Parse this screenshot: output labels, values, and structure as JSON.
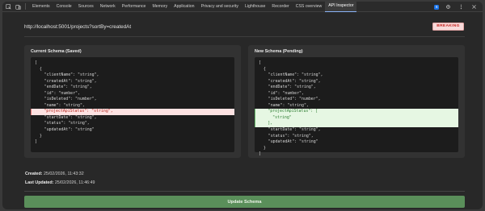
{
  "devtools": {
    "tabs": [
      {
        "label": "Elements"
      },
      {
        "label": "Console"
      },
      {
        "label": "Sources"
      },
      {
        "label": "Network"
      },
      {
        "label": "Performance"
      },
      {
        "label": "Memory"
      },
      {
        "label": "Application"
      },
      {
        "label": "Privacy and security"
      },
      {
        "label": "Lighthouse"
      },
      {
        "label": "Recorder"
      },
      {
        "label": "CSS overview"
      },
      {
        "label": "API Inspector",
        "active": true
      }
    ],
    "issues_count": "6"
  },
  "header": {
    "url": "http://localhost:5001/projects?sortBy=createdAt",
    "status_badge": "BREAKING"
  },
  "current_schema": {
    "title": "Current Schema (Saved)",
    "lines": [
      {
        "text": "["
      },
      {
        "text": "  {"
      },
      {
        "text": "    \"clientName\": \"string\","
      },
      {
        "text": "    \"createdAt\": \"string\","
      },
      {
        "text": "    \"endDate\": \"string\","
      },
      {
        "text": "    \"id\": \"number\","
      },
      {
        "text": "    \"isDeleted\": \"number\","
      },
      {
        "text": "    \"name\": \"string\","
      },
      {
        "text": "    \"projectApiStatus\": \"string\",",
        "diff": "removed"
      },
      {
        "text": "    \"startDate\": \"string\","
      },
      {
        "text": "    \"status\": \"string\","
      },
      {
        "text": "    \"updatedAt\": \"string\""
      },
      {
        "text": "  }"
      },
      {
        "text": "]"
      }
    ]
  },
  "new_schema": {
    "title": "New Schema (Pending)",
    "lines": [
      {
        "text": "["
      },
      {
        "text": "  {"
      },
      {
        "text": "    \"clientName\": \"string\","
      },
      {
        "text": "    \"createdAt\": \"string\","
      },
      {
        "text": "    \"endDate\": \"string\","
      },
      {
        "text": "    \"id\": \"number\","
      },
      {
        "text": "    \"isDeleted\": \"number\","
      },
      {
        "text": "    \"name\": \"string\","
      },
      {
        "text": "    \"projectApiStatus\": [",
        "diff": "added"
      },
      {
        "text": "      \"string\"",
        "diff": "added"
      },
      {
        "text": "    ],",
        "diff": "added"
      },
      {
        "text": "    \"startDate\": \"string\","
      },
      {
        "text": "    \"status\": \"string\","
      },
      {
        "text": "    \"updatedAt\": \"string\""
      },
      {
        "text": "  }"
      },
      {
        "text": "]"
      }
    ]
  },
  "meta": {
    "created_label": "Created:",
    "created_value": "25/02/2026, 11:43:32",
    "updated_label": "Last Updated:",
    "updated_value": "25/02/2026, 11:46:49"
  },
  "actions": {
    "update_label": "Update Schema"
  },
  "colors": {
    "removed_bg": "#fde2e2",
    "added_bg": "#e6f7e3",
    "button_bg": "#5a8f5a",
    "badge_text": "#c5221f"
  }
}
